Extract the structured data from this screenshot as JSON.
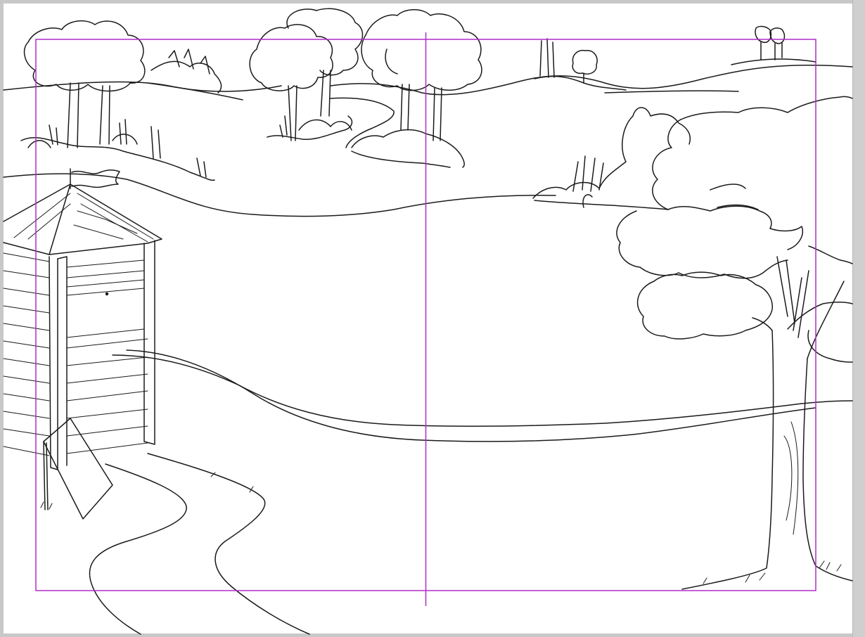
{
  "canvas": {
    "background_color": "#ffffff",
    "workspace_color": "#c8c8c8",
    "ink_color": "#1a1a1a",
    "guide_color": "#b02cc8"
  },
  "scene": {
    "subject": "line-art-landscape",
    "elements": [
      "hut-icon",
      "flag-icon",
      "tree-icon",
      "bush-icon",
      "path-icon",
      "stream-icon",
      "grass-icon",
      "hill-icon"
    ]
  }
}
